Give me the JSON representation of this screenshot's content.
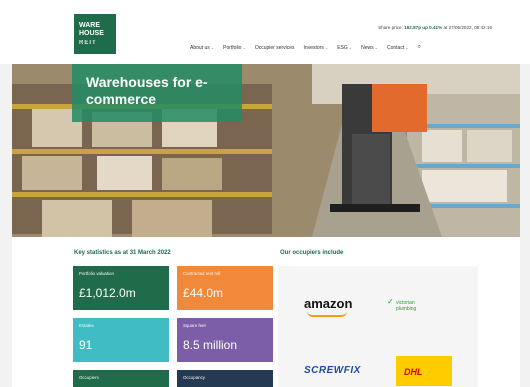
{
  "header": {
    "logo": {
      "line1": "WARE",
      "line2": "HOUSE",
      "line3": "REIT"
    },
    "share_price": {
      "prefix": "Share price: ",
      "value": "162.87p up 0.41%",
      "suffix": " at 27/05/2022, 08:42:16"
    },
    "nav": [
      {
        "label": "About us"
      },
      {
        "label": "Portfolio"
      },
      {
        "label": "Occupier services"
      },
      {
        "label": "Investors"
      },
      {
        "label": "ESG"
      },
      {
        "label": "News"
      },
      {
        "label": "Contact"
      }
    ]
  },
  "hero": {
    "title": "Warehouses for e-commerce"
  },
  "stats": {
    "title": "Key statistics as at 31 March 2022",
    "tiles": [
      {
        "label": "Portfolio valuation",
        "value": "£1,012.0m",
        "color": "#1f6b4a"
      },
      {
        "label": "Contracted rent roll",
        "value": "£44.0m",
        "color": "#f0893a"
      },
      {
        "label": "Estates",
        "value": "91",
        "color": "#3fbcc4"
      },
      {
        "label": "Square feet",
        "value": "8.5 million",
        "color": "#7b5ea7"
      },
      {
        "label": "Occupiers",
        "value": "",
        "color": "#1f6b4a"
      },
      {
        "label": "Occupancy",
        "value": "",
        "color": "#233a52"
      }
    ]
  },
  "occupiers": {
    "title": "Our occupiers include",
    "logos": {
      "amazon": "amazon",
      "victorian_plumbing_line1": "victorian",
      "victorian_plumbing_line2": "plumbing",
      "screwfix": "SCREWFIX",
      "dhl": "DHL"
    }
  }
}
